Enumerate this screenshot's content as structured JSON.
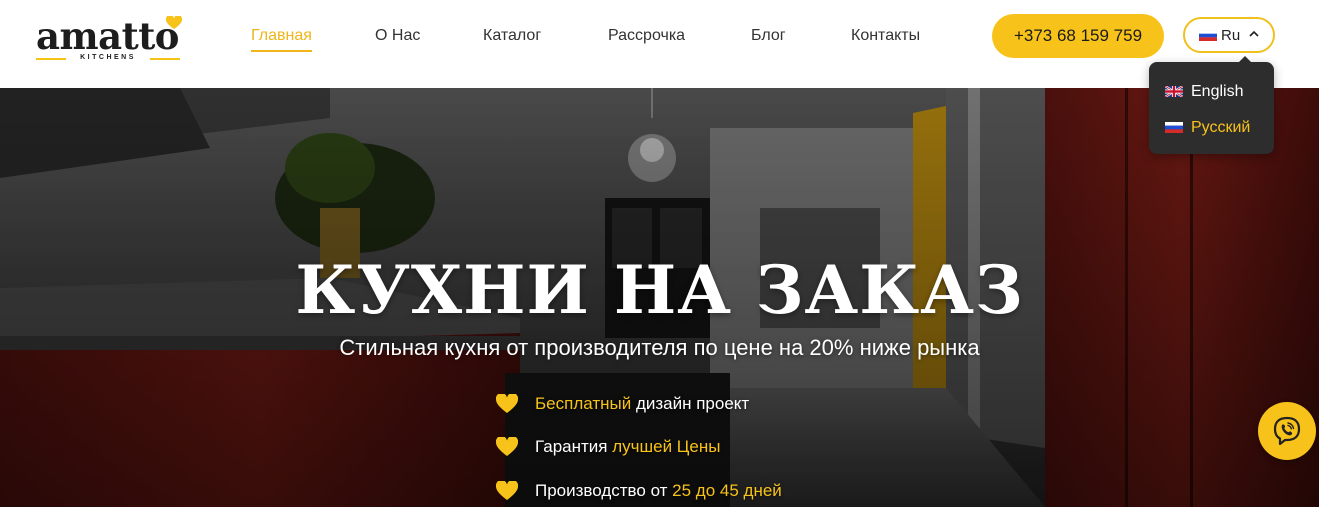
{
  "brand": {
    "name": "amatto",
    "tagline": "KITCHENS",
    "accent": "#f7c21a",
    "dark": "#1d1d1d"
  },
  "nav": {
    "items": [
      {
        "label": "Главная",
        "active": true
      },
      {
        "label": "О Нас"
      },
      {
        "label": "Каталог"
      },
      {
        "label": "Рассрочка"
      },
      {
        "label": "Блог"
      },
      {
        "label": "Контакты"
      }
    ]
  },
  "header": {
    "phone": "+373 68 159 759",
    "language": {
      "current": "Ru",
      "options": [
        "English",
        "Русский"
      ],
      "selected": "Русский"
    }
  },
  "hero": {
    "title": "КУХНИ НА ЗАКАЗ",
    "subtitle": "Стильная кухня от производителя по цене на 20% ниже рынка",
    "features": [
      {
        "highlight": "Бесплатный",
        "rest": " дизайн проект"
      },
      {
        "prefix": "Гарантия ",
        "highlight": "лучшей Цены"
      },
      {
        "prefix": "Производство от ",
        "highlight": "25 до 45 дней"
      }
    ]
  },
  "icons": {
    "viber": "viber-icon",
    "chevron": "chevron-up-icon",
    "heart": "heart-icon"
  }
}
